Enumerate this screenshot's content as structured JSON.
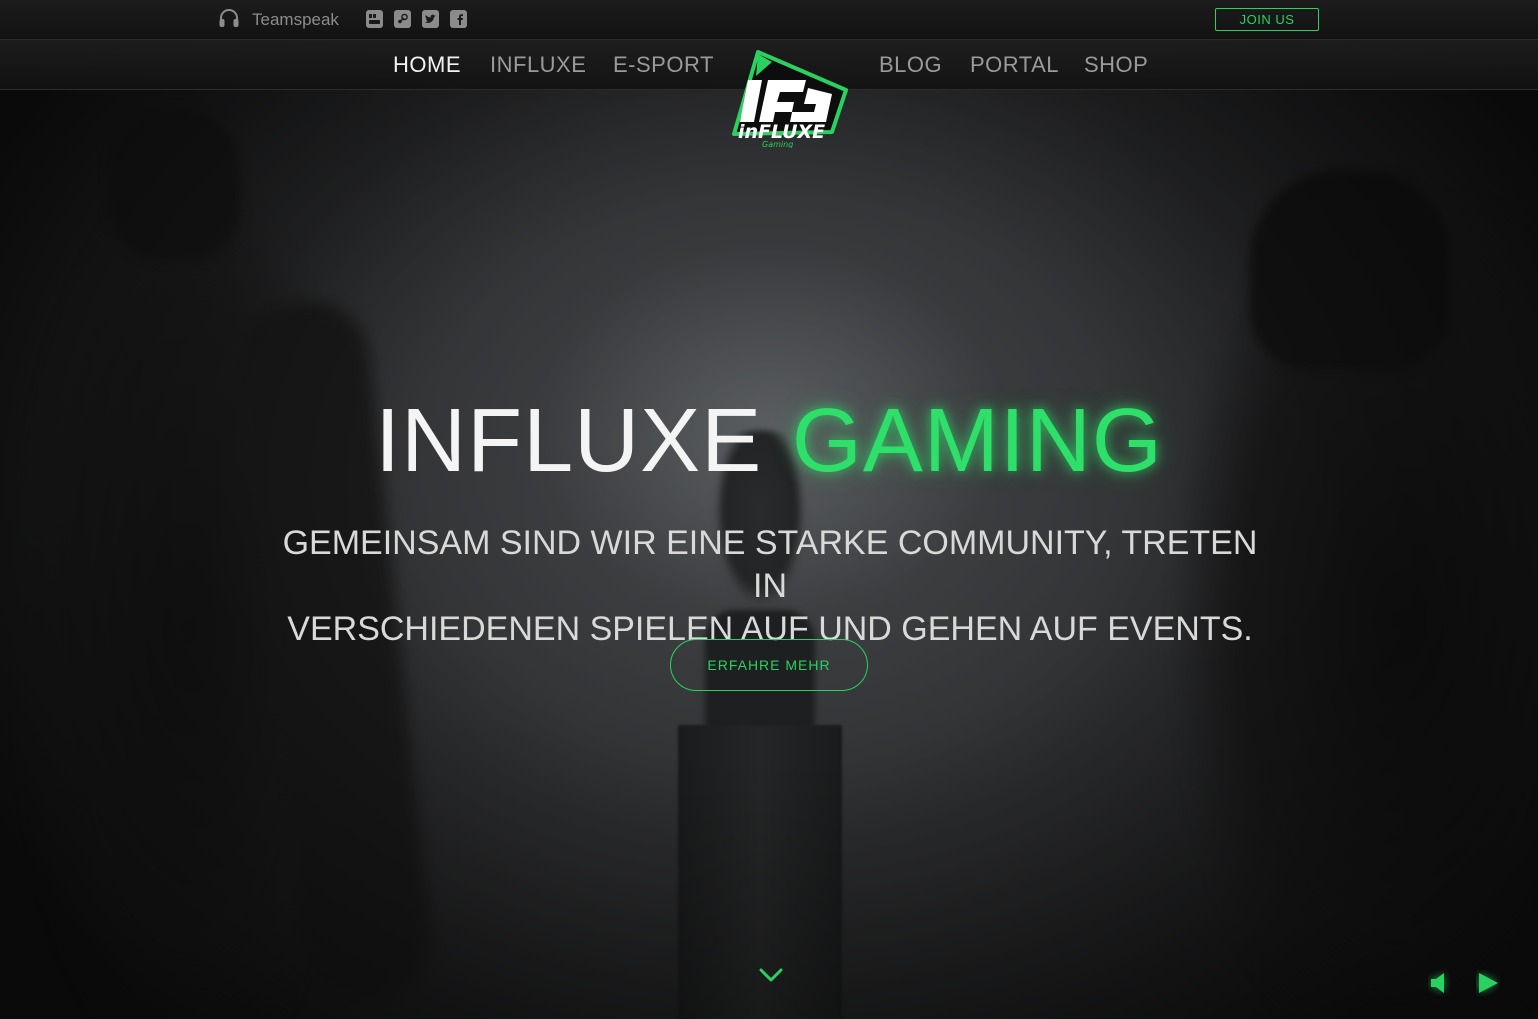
{
  "topbar": {
    "teamspeak_label": "Teamspeak",
    "social_icons": [
      "youtube-icon",
      "steam-icon",
      "twitter-icon",
      "facebook-icon"
    ],
    "join_label": "JOIN US"
  },
  "nav": {
    "left_items": [
      "HOME",
      "INFLUXE",
      "E-SPORT"
    ],
    "right_items": [
      "BLOG",
      "PORTAL",
      "SHOP"
    ],
    "active": "HOME"
  },
  "logo": {
    "main": "inFLUXE",
    "sub": "Gaming"
  },
  "hero": {
    "title_white": "INFLUXE",
    "title_green": "GAMING",
    "subtitle_line1": "GEMEINSAM SIND WIR EINE STARKE COMMUNITY, TRETEN IN",
    "subtitle_line2": "VERSCHIEDENEN SPIELEN AUF UND GEHEN AUF EVENTS.",
    "cta_label": "ERFAHRE MEHR"
  },
  "colors": {
    "accent": "#2bd160",
    "nav_text": "#9a9a9a",
    "nav_active": "#f2f2f2",
    "background": "#141414"
  }
}
